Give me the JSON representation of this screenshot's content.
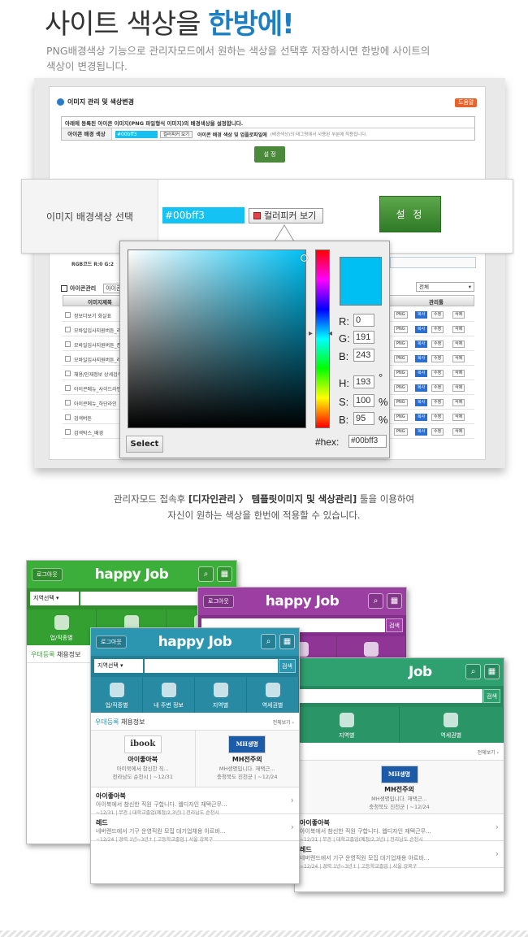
{
  "hero": {
    "title_plain": "사이트 색상을 ",
    "title_highlight": "한방에!",
    "desc": "PNG배경색상 기능으로 관리자모드에서 원하는 색상을 선택후 저장하시면 한방에 사이트의\n색상이 변경됩니다."
  },
  "admin_panel": {
    "title": "이미지 관리 및 색상변경",
    "help_label": "도움말",
    "note": "아래에 등록된 아이콘 이미지(PNG 파일형식 이미지)의 배경색상을 설정합니다.",
    "row_label": "아이콘 배경 색상",
    "row_value": "#00bff3",
    "row_picker": "컬러피커 보기",
    "row_text": "아이콘 배경 색상 및 업플로파일에",
    "row_text2": "(배경색상)의 태그명에서 사용된 부분에 적용됩니다.",
    "set_label": "설 정",
    "rgb_label": "RGB코드 R:0 G:2",
    "img_mgmt": "아이콘관리",
    "img_mgmt_value": "아이콘",
    "dropdown": "전체",
    "col_title": "이미지제목",
    "col_manage": "관리툴",
    "rows": [
      "정보더보기 화살표",
      "모바일입사지원버튼_리",
      "모바일입사지원버튼_존",
      "모바일입사지원버튼_레",
      "채용/인재정보 상세검색",
      "아이콘메뉴_사이드라인",
      "아이콘메뉴_하단라인",
      "검색버튼",
      "검색박스_배경"
    ],
    "row_btns": [
      "PNG",
      "복사",
      "수정",
      "삭제"
    ]
  },
  "zoom": {
    "label": "이미지 배경색상 선택",
    "value": "#00bff3",
    "picker_label": "컬러피커 보기",
    "set_label": "설 정"
  },
  "picker": {
    "r_label": "R:",
    "r": "0",
    "g_label": "G:",
    "g": "191",
    "b_label": "B:",
    "b": "243",
    "h_label": "H:",
    "h": "193",
    "h_unit": "°",
    "s_label": "S:",
    "s": "100",
    "s_unit": "%",
    "bv_label": "B:",
    "bv": "95",
    "bv_unit": "%",
    "hex_label": "#hex:",
    "hex": "#00bff3",
    "select": "Select"
  },
  "middle": {
    "line1_a": "관리자모드 접속후 ",
    "line1_b": "[디자인관리 〉 템플릿이미지 및 색상관리]",
    "line1_c": " 툴을 이용하여",
    "line2": "자신이 원하는 색상을 한번에 적용할 수 있습니다."
  },
  "phone": {
    "logo": "happy Job",
    "login": "로그아웃",
    "region": "지역선택",
    "search_btn": "검색",
    "menu": [
      "업/직종별",
      "내 주변 정보",
      "지역별",
      "역세권별"
    ],
    "section_a": "우대등록",
    "section_b": " 채용정보",
    "more": "전체보기 ›",
    "cards": [
      {
        "logo": "ibook",
        "title": "아이좋아북",
        "desc": "아이북에서 참신한 직...",
        "meta": "전라남도 순천시 | ~12/31"
      },
      {
        "logo": "MH생명",
        "title": "MH전주의",
        "desc": "MH생명입니다. 재택근...",
        "meta": "충청북도 진천군 | ~12/24"
      }
    ],
    "items": [
      {
        "title": "아이좋아북",
        "desc": "아이북에서 참신한 직원 구합니다. 웹디자인 재택근무...",
        "meta": "~12/31 | 무관 | 대학교졸업(예정/2,3년) | 전라남도 순천시"
      },
      {
        "title": "레드",
        "desc": "네버랜드에서 기구 운영직원 모집 대기업채용 아르바...",
        "meta": "~12/24 | 경력 1년~3년↑ | 고등학교졸업 | 서울 강북구"
      }
    ],
    "colors": {
      "green": "#3cae3a",
      "purple": "#9b3fa3",
      "teal": "#2c96b0",
      "emerald": "#2fa070"
    }
  }
}
